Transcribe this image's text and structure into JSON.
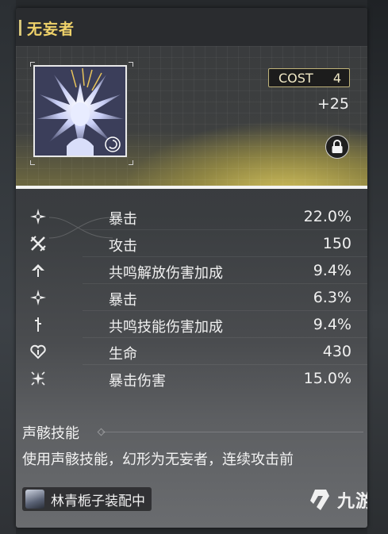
{
  "echo": {
    "name": "无妄者",
    "cost_label": "COST",
    "cost_value": "4",
    "level": "+25"
  },
  "stats": [
    {
      "icon": "crit-rate-icon",
      "name": "暴击",
      "value": "22.0%"
    },
    {
      "icon": "attack-icon",
      "name": "攻击",
      "value": "150"
    },
    {
      "icon": "resonance-liberation-icon",
      "name": "共鸣解放伤害加成",
      "value": "9.4%"
    },
    {
      "icon": "crit-rate-icon",
      "name": "暴击",
      "value": "6.3%"
    },
    {
      "icon": "resonance-skill-icon",
      "name": "共鸣技能伤害加成",
      "value": "9.4%"
    },
    {
      "icon": "hp-icon",
      "name": "生命",
      "value": "430"
    },
    {
      "icon": "crit-damage-icon",
      "name": "暴击伤害",
      "value": "15.0%"
    }
  ],
  "skill": {
    "title": "声骸技能",
    "description": "使用声骸技能，幻形为无妄者，连续攻击前"
  },
  "equipped_by": "林青栀子装配中",
  "watermark": "九游",
  "colors": {
    "title_gold": "#efd26a",
    "hero_glow": "#d6c45c",
    "text": "#f0f0f0"
  }
}
